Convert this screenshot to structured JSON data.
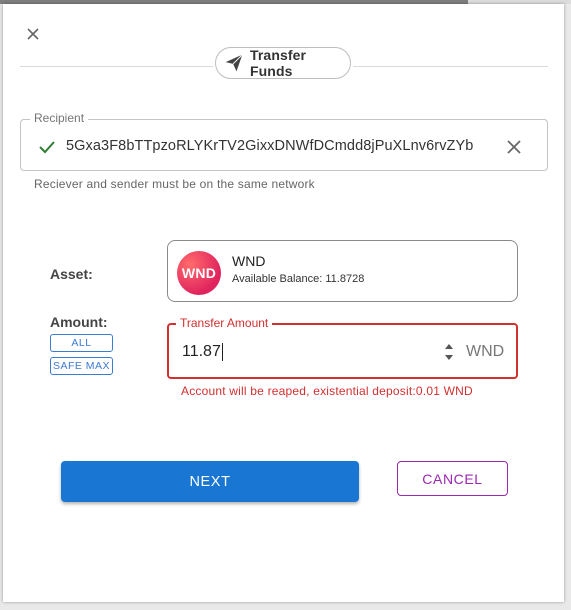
{
  "dialog": {
    "title": "Transfer Funds"
  },
  "recipient": {
    "legend": "Recipient",
    "address": "5Gxa3F8bTTpzoRLYKrTV2GixxDNWfDCmdd8jPuXLnv6rvZYb",
    "helper": "Reciever and sender must be on the same network"
  },
  "asset": {
    "label": "Asset:",
    "logo_text": "WND",
    "name": "WND",
    "balance": "Available Balance: 11.8728"
  },
  "amount": {
    "label": "Amount:",
    "all_label": "ALL",
    "safe_max_label": "SAFE MAX",
    "legend": "Transfer Amount",
    "value": "11.87",
    "unit": "WND",
    "error": "Account will be reaped, existential deposit:0.01 WND"
  },
  "actions": {
    "next_label": "NEXT",
    "cancel_label": "CANCEL"
  },
  "colors": {
    "primary": "#1976d2",
    "secondary": "#9c27b0",
    "error": "#d32f2f",
    "success": "#2e7d32"
  }
}
